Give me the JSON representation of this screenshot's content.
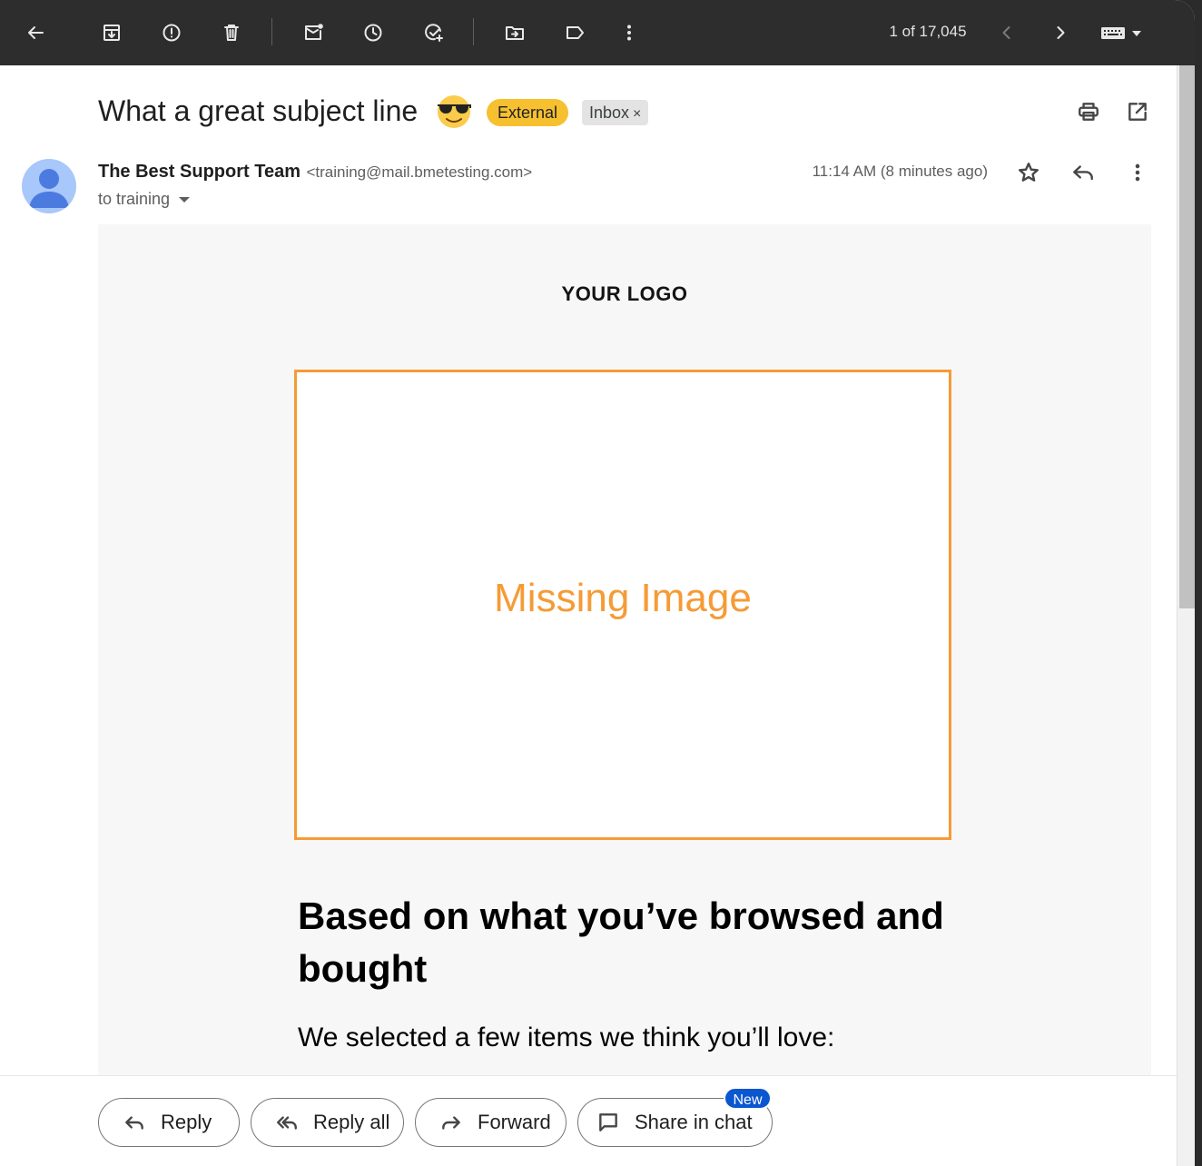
{
  "toolbar": {
    "counter": "1 of 17,045",
    "icons": [
      "back-arrow-icon",
      "archive-icon",
      "report-spam-icon",
      "delete-icon",
      "mark-unread-icon",
      "snooze-icon",
      "add-to-tasks-icon",
      "move-to-icon",
      "label-icon",
      "more-vert-icon",
      "prev-icon",
      "next-icon",
      "keyboard-icon"
    ]
  },
  "message": {
    "subject": "What a great subject line",
    "chips": {
      "external": "External",
      "inbox": "Inbox",
      "inbox_remove": "×"
    },
    "sender_name": "The Best Support Team",
    "sender_email": "<training@mail.bmetesting.com>",
    "recipients": "to training",
    "timestamp": "11:14 AM (8 minutes ago)"
  },
  "email_content": {
    "logo": "YOUR LOGO",
    "image_placeholder": "Missing Image",
    "headline": "Based on what you’ve browsed and bought",
    "subline": "We selected a few items we think you’ll love:"
  },
  "actions": {
    "reply": "Reply",
    "reply_all": "Reply all",
    "forward": "Forward",
    "share_in_chat": "Share in chat",
    "new_badge": "New"
  },
  "colors": {
    "toolbar_bg": "#2d2d2d",
    "external_chip": "#f6c02f",
    "placeholder_accent": "#f59b36",
    "new_badge": "#0b57d0"
  }
}
